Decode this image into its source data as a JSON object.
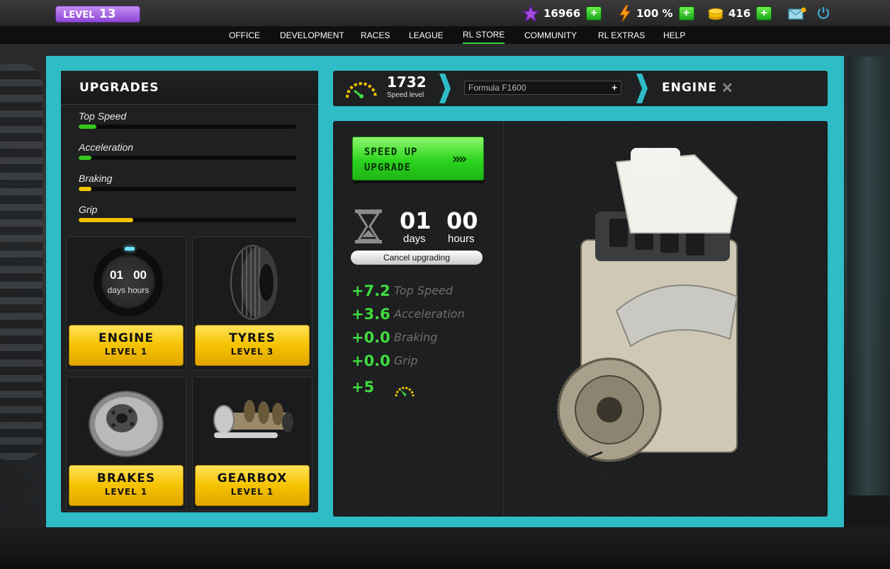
{
  "topbar": {
    "level_label": "LEVEL",
    "level_value": "13",
    "stars": "16966",
    "energy": "100 %",
    "coins": "416",
    "plus": "+"
  },
  "menu": [
    "OFFICE",
    "DEVELOPMENT",
    "RACES",
    "LEAGUE",
    "RL STORE",
    "COMMUNITY",
    "RL EXTRAS",
    "HELP"
  ],
  "upgrades": {
    "title": "UPGRADES",
    "stats": [
      {
        "label": "Top Speed",
        "fraction": 0.08,
        "color": "#35c81c"
      },
      {
        "label": "Acceleration",
        "fraction": 0.06,
        "color": "#35c81c"
      },
      {
        "label": "Braking",
        "fraction": 0.06,
        "color": "#f2c400"
      },
      {
        "label": "Grip",
        "fraction": 0.25,
        "color": "#f2c400"
      }
    ],
    "parts": [
      {
        "name": "ENGINE",
        "level": "LEVEL 1",
        "timer_days": "01",
        "timer_hours": "00",
        "unit_days": "days",
        "unit_hours": "hours"
      },
      {
        "name": "TYRES",
        "level": "LEVEL 3"
      },
      {
        "name": "BRAKES",
        "level": "LEVEL 1"
      },
      {
        "name": "GEARBOX",
        "level": "LEVEL 1"
      }
    ]
  },
  "header": {
    "speed_level_value": "1732",
    "speed_level_label": "Speed level",
    "car": "Formula F1600",
    "car_plus": "+",
    "title": "ENGINE",
    "close": "✕"
  },
  "upgrade_panel": {
    "speedup_line1": "SPEED UP",
    "speedup_line2": "UPGRADE",
    "speedup_arrows": "»»",
    "days": "01",
    "days_label": "days",
    "hours": "00",
    "hours_label": "hours",
    "cancel_label": "Cancel upgrading",
    "bonuses": [
      {
        "value": "+7.2",
        "label": "Top Speed"
      },
      {
        "value": "+3.6",
        "label": "Acceleration"
      },
      {
        "value": "+0.0",
        "label": "Braking"
      },
      {
        "value": "+0.0",
        "label": "Grip"
      }
    ],
    "speed_bonus": "+5"
  },
  "colors": {
    "frame": "#2ebcc6",
    "accent_green": "#3fdc3f",
    "part_button": "#f5c300",
    "level_badge": "#a860e4"
  }
}
